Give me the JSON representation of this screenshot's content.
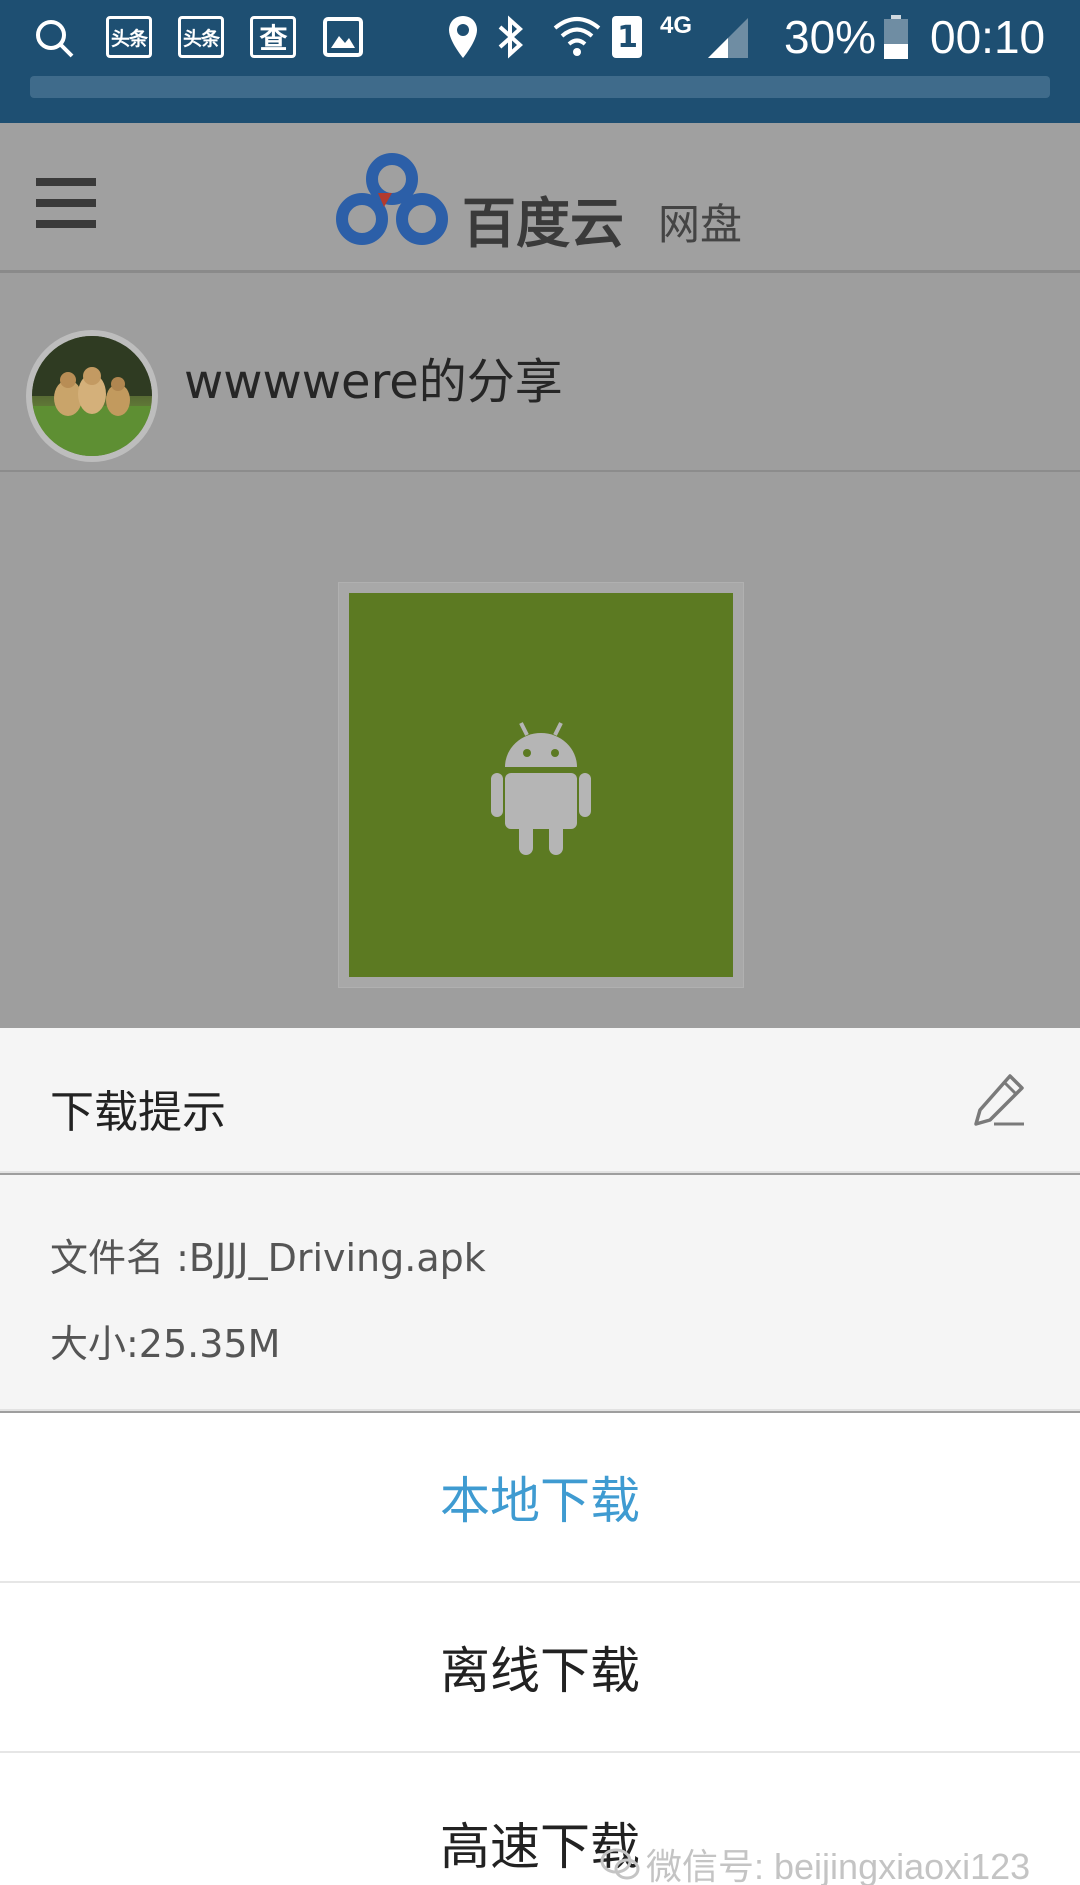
{
  "status_bar": {
    "badge_1": "头条",
    "badge_2": "头条",
    "badge_3": "查",
    "network_type": "4G",
    "sim_slot": "1",
    "battery_percent": "30%",
    "time": "00:10"
  },
  "header": {
    "brand_name": "百度云",
    "brand_sub": "网盘"
  },
  "share": {
    "owner_title": "wwwwere的分享"
  },
  "dialog": {
    "title": "下载提示",
    "file_name": "文件名 :BJJJ_Driving.apk",
    "file_size": "大小:25.35M",
    "actions": [
      {
        "label": "本地下载"
      },
      {
        "label": "离线下载"
      },
      {
        "label": "高速下载"
      }
    ]
  },
  "watermark": {
    "text": "微信号: beijingxiaoxi123"
  },
  "colors": {
    "status_bar": "#1e4f72",
    "dim_background": "#9e9e9e",
    "accent_link": "#3f9bd1",
    "file_tile": "#5c7a22"
  }
}
